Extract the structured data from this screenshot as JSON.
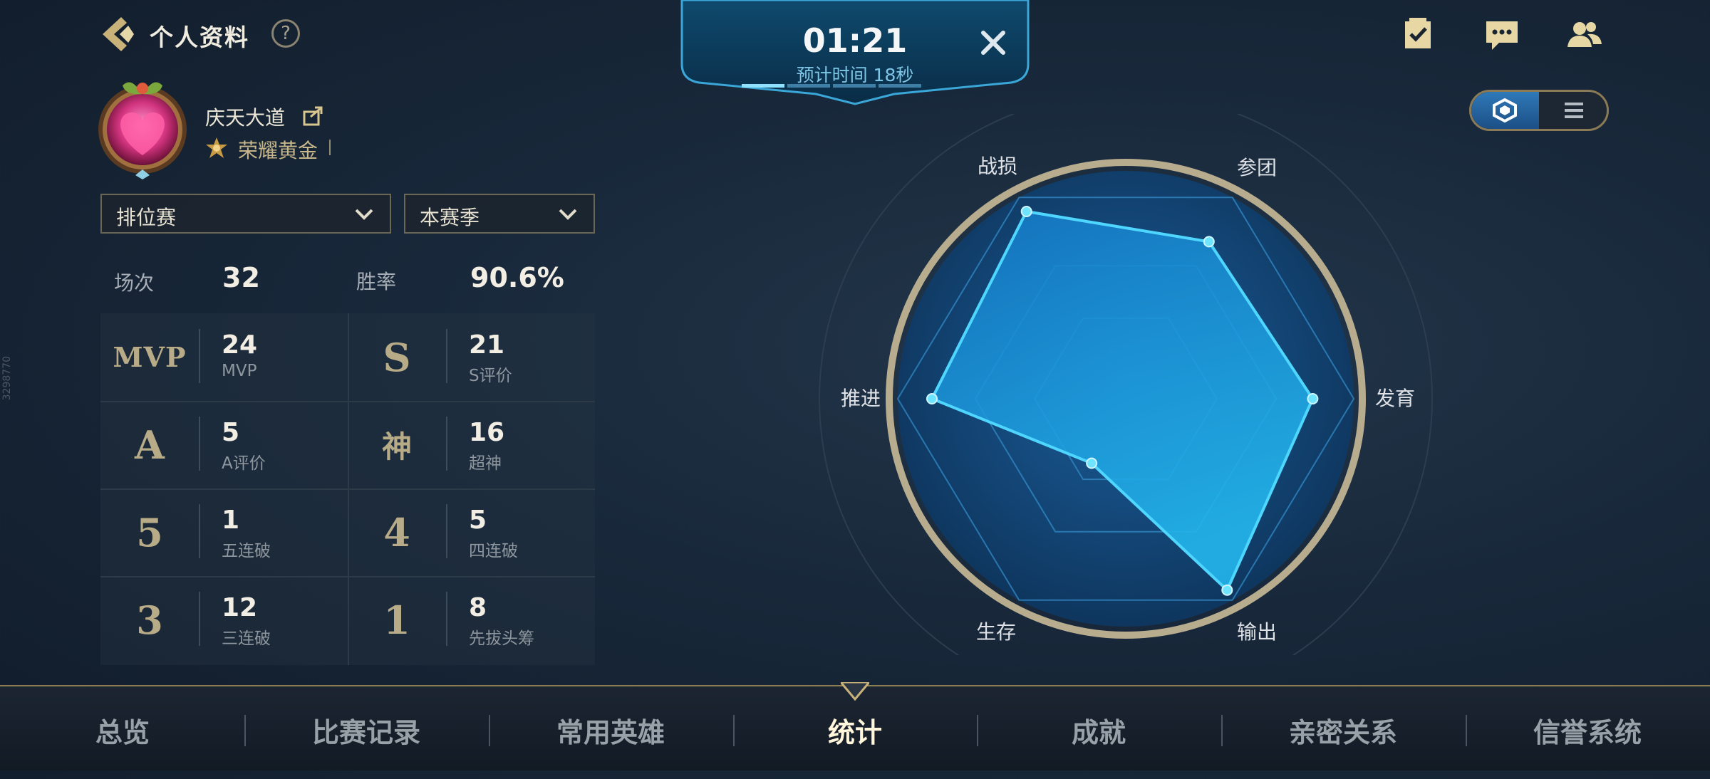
{
  "header": {
    "title": "个人资料",
    "help": "?"
  },
  "profile": {
    "name": "庆天大道",
    "rank": "荣耀黄金"
  },
  "filters": {
    "mode": "排位赛",
    "season": "本赛季"
  },
  "summary": {
    "matches_label": "场次",
    "matches": "32",
    "winrate_label": "胜率",
    "winrate": "90.6%"
  },
  "stats": [
    {
      "badge": "MVP",
      "value": "24",
      "caption": "MVP"
    },
    {
      "badge": "S",
      "value": "21",
      "caption": "S评价"
    },
    {
      "badge": "A",
      "value": "5",
      "caption": "A评价"
    },
    {
      "badge": "神",
      "value": "16",
      "caption": "超神"
    },
    {
      "badge": "5",
      "value": "1",
      "caption": "五连破"
    },
    {
      "badge": "4",
      "value": "5",
      "caption": "四连破"
    },
    {
      "badge": "3",
      "value": "12",
      "caption": "三连破"
    },
    {
      "badge": "1",
      "value": "8",
      "caption": "先拔头筹"
    }
  ],
  "timer": {
    "time": "01:21",
    "subtitle": "预计时间 18秒"
  },
  "radar": {
    "axes": [
      "战损",
      "参团",
      "发育",
      "输出",
      "生存",
      "推进"
    ]
  },
  "chart_data": {
    "type": "radar",
    "categories": [
      "参团",
      "发育",
      "输出",
      "生存",
      "推进",
      "战损"
    ],
    "values": [
      0.78,
      0.82,
      0.95,
      0.32,
      0.85,
      0.93
    ],
    "range": [
      0,
      1
    ]
  },
  "nav": {
    "items": [
      "总览",
      "比赛记录",
      "常用英雄",
      "统计",
      "成就",
      "亲密关系",
      "信誉系统"
    ],
    "active": "统计"
  },
  "side_text": "3298770",
  "colors": {
    "accent": "#35c8ff",
    "gold": "#b8ab88"
  }
}
